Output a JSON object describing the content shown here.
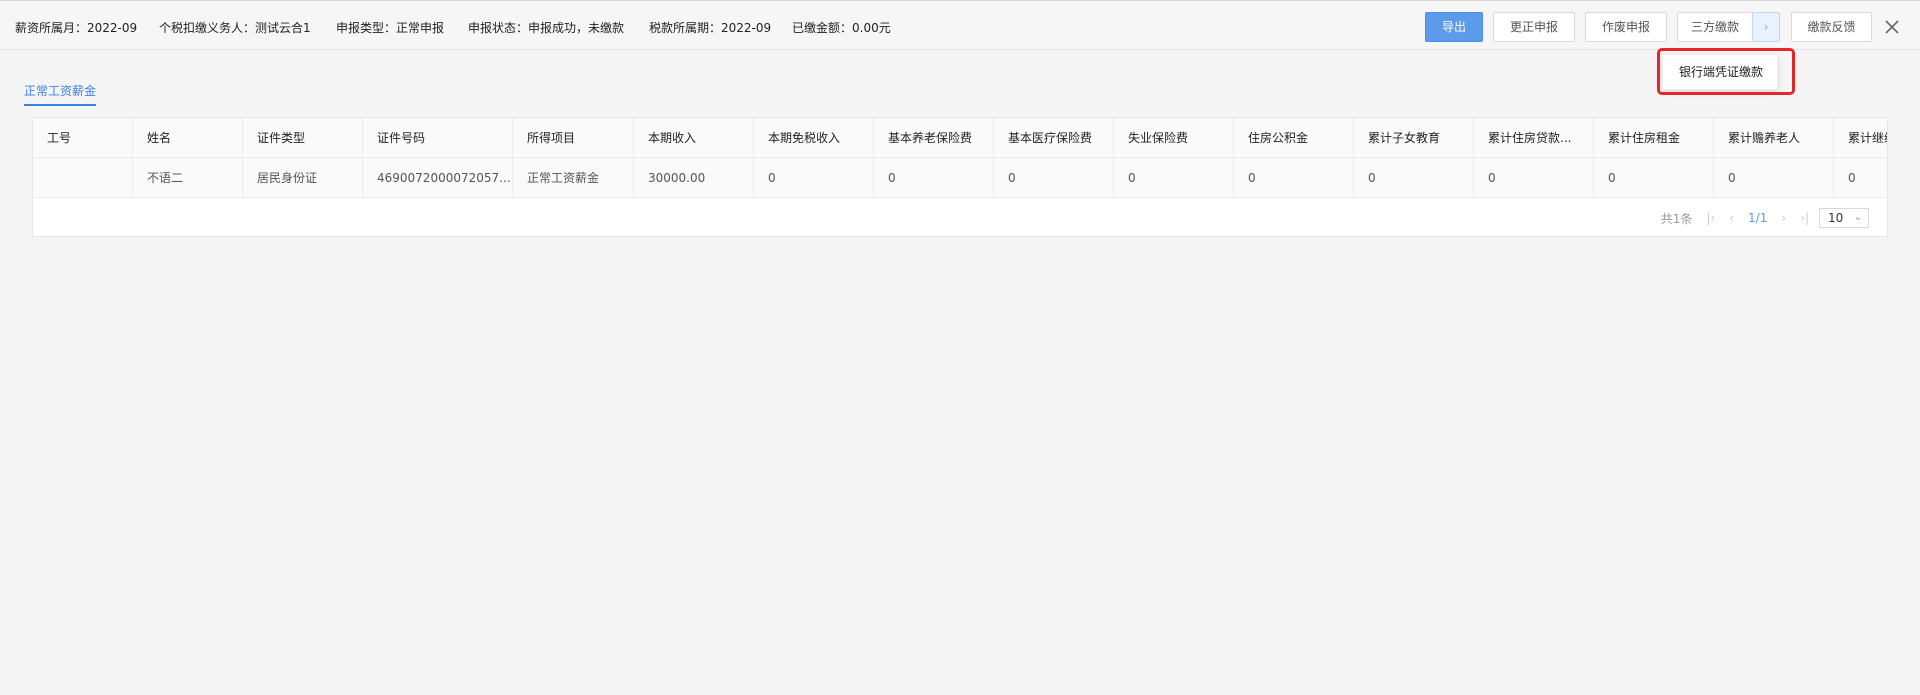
{
  "info": {
    "salary_month": "薪资所属月：2022-09",
    "withholder": "个税扣缴义务人：测试云合1",
    "declare_type": "申报类型：正常申报",
    "declare_status": "申报状态：申报成功，未缴款",
    "tax_period": "税款所属期：2022-09",
    "paid_amount": "已缴金额：0.00元"
  },
  "toolbar": {
    "export": "导出",
    "correct": "更正申报",
    "void": "作废申报",
    "third_party": "三方缴款",
    "arrow": "›",
    "feedback": "缴款反馈",
    "close": "×"
  },
  "dropdown": {
    "bank_voucher": "银行端凭证缴款"
  },
  "tab": {
    "label": "正常工资薪金"
  },
  "table": {
    "headers": [
      "工号",
      "姓名",
      "证件类型",
      "证件号码",
      "所得项目",
      "本期收入",
      "本期免税收入",
      "基本养老保险费",
      "基本医疗保险费",
      "失业保险费",
      "住房公积金",
      "累计子女教育",
      "累计住房贷款...",
      "累计住房租金",
      "累计赡养老人",
      "累计继续"
    ],
    "rows": [
      [
        "",
        "不语二",
        "居民身份证",
        "4690072000072057...",
        "正常工资薪金",
        "30000.00",
        "0",
        "0",
        "0",
        "0",
        "0",
        "0",
        "0",
        "0",
        "0",
        "0"
      ]
    ]
  },
  "pagination": {
    "total": "共1条",
    "first": "|‹",
    "prev": "‹",
    "current": "1/1",
    "next": "›",
    "last": "›|",
    "page_size": "10",
    "chevron": "⌄"
  },
  "colors": {
    "primary": "#5b9bea",
    "highlight": "#e5262b",
    "tab": "#3b82e2"
  }
}
